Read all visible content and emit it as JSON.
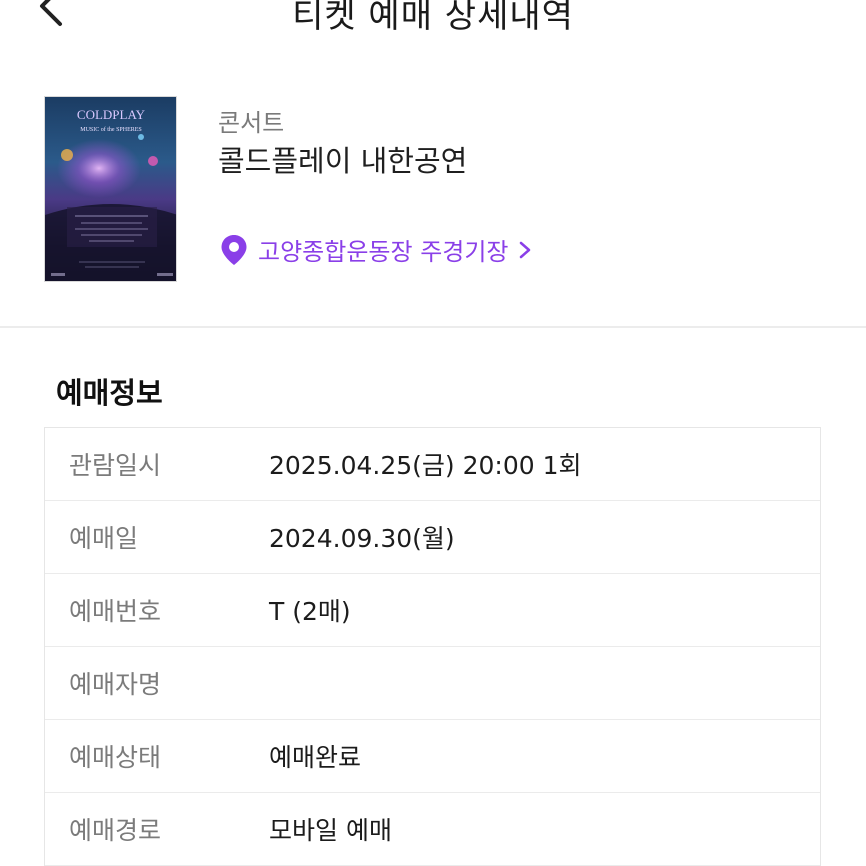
{
  "header": {
    "title": "티켓 예매 상세내역"
  },
  "event": {
    "category": "콘서트",
    "title": "콜드플레이 내한공연",
    "venue": "고양종합운동장 주경기장",
    "poster": {
      "band": "COLDPLAY",
      "subtitle": "MUSIC of the SPHERES"
    }
  },
  "booking_info": {
    "section_title": "예매정보",
    "rows": [
      {
        "label": "관람일시",
        "value": "2025.04.25(금) 20:00 1회"
      },
      {
        "label": "예매일",
        "value": "2024.09.30(월)"
      },
      {
        "label": "예매번호",
        "value": "T (2매)"
      },
      {
        "label": "예매자명",
        "value": ""
      },
      {
        "label": "예매상태",
        "value": "예매완료"
      },
      {
        "label": "예매경로",
        "value": "모바일 예매"
      }
    ]
  },
  "colors": {
    "accent": "#8a3fe8",
    "label": "#7b7b7b",
    "border": "#e6e6e6"
  },
  "icons": {
    "back": "chevron-left-icon",
    "venue": "location-pin-icon",
    "venue_link": "chevron-right-icon"
  }
}
